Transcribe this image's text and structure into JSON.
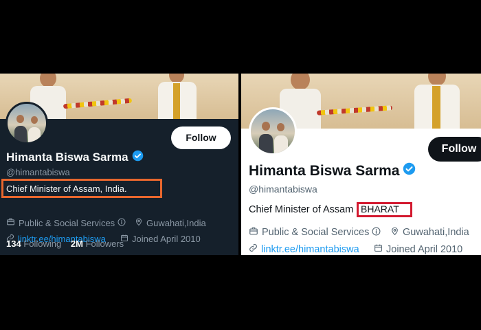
{
  "left": {
    "theme": "dark",
    "follow_label": "Follow",
    "name": "Himanta Biswa Sarma",
    "handle": "@himantabiswa",
    "bio": "Chief Minister of Assam, India.",
    "category": "Public & Social Services",
    "location": "Guwahati,India",
    "link": "linktr.ee/himantabiswa",
    "joined": "Joined April 2010",
    "following_count": "134",
    "following_label": "Following",
    "followers_count": "2M",
    "followers_label": "Followers",
    "highlight_color": "#e8672e"
  },
  "right": {
    "theme": "light",
    "follow_label": "Follow",
    "name": "Himanta Biswa Sarma",
    "handle": "@himantabiswa",
    "bio_prefix": "Chief Minister of Assam",
    "bio_highlight": "BHARAT",
    "category": "Public & Social Services",
    "location": "Guwahati,India",
    "link": "linktr.ee/himantabiswa",
    "joined": "Joined April 2010",
    "highlight_color": "#d3192f"
  },
  "colors": {
    "verified": "#1d9bf0",
    "link": "#1d9bf0"
  },
  "icons": [
    "verified-badge-icon",
    "briefcase-icon",
    "info-icon",
    "location-pin-icon",
    "link-icon",
    "calendar-icon"
  ]
}
